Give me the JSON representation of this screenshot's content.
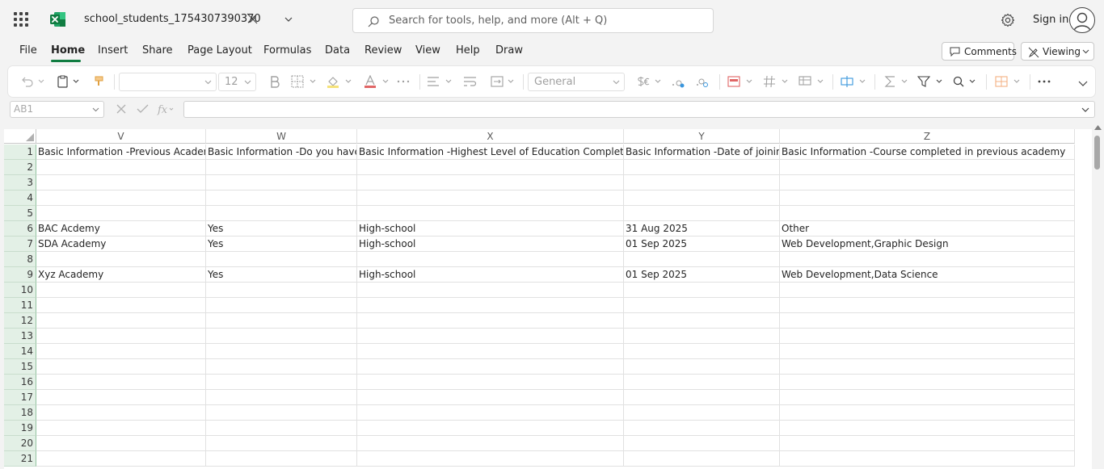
{
  "app": {
    "doc_title": "school_students_1754307390370",
    "search_placeholder": "Search for tools, help, and more (Alt + Q)",
    "signin_label": "Sign in",
    "brand_color": "#107c41"
  },
  "menu": {
    "tabs": [
      {
        "label": "File"
      },
      {
        "label": "Home"
      },
      {
        "label": "Insert"
      },
      {
        "label": "Share"
      },
      {
        "label": "Page Layout"
      },
      {
        "label": "Formulas"
      },
      {
        "label": "Data"
      },
      {
        "label": "Review"
      },
      {
        "label": "View"
      },
      {
        "label": "Help"
      },
      {
        "label": "Draw"
      }
    ],
    "active_tab": "Home",
    "comments_label": "Comments",
    "viewing_label": "Viewing"
  },
  "ribbon": {
    "font_name": "",
    "font_size": "12",
    "number_format": "General"
  },
  "formula_bar": {
    "name_box": "AB1",
    "formula": ""
  },
  "sheet": {
    "columns": [
      {
        "letter": "V"
      },
      {
        "letter": "W"
      },
      {
        "letter": "X"
      },
      {
        "letter": "Y"
      },
      {
        "letter": "Z"
      }
    ],
    "row_numbers": [
      "1",
      "2",
      "3",
      "4",
      "5",
      "6",
      "7",
      "8",
      "9",
      "10",
      "11",
      "12",
      "13",
      "14",
      "15",
      "16",
      "17",
      "18",
      "19",
      "20",
      "21"
    ],
    "rows": [
      [
        "Basic Information -Previous Academy",
        "Basic Information -Do you have a",
        "Basic Information -Highest Level of Education Completed",
        "Basic Information -Date of joining",
        "Basic Information -Course completed in previous academy"
      ],
      [
        "",
        "",
        "",
        "",
        ""
      ],
      [
        "",
        "",
        "",
        "",
        ""
      ],
      [
        "",
        "",
        "",
        "",
        ""
      ],
      [
        "",
        "",
        "",
        "",
        ""
      ],
      [
        "BAC Acdemy",
        "Yes",
        "High-school",
        "31 Aug 2025",
        "Other"
      ],
      [
        "SDA Academy",
        "Yes",
        "High-school",
        "01 Sep 2025",
        "Web Development,Graphic Design"
      ],
      [
        "",
        "",
        "",
        "",
        ""
      ],
      [
        "Xyz Academy",
        "Yes",
        "High-school",
        "01 Sep 2025",
        "Web Development,Data Science"
      ],
      [
        "",
        "",
        "",
        "",
        ""
      ],
      [
        "",
        "",
        "",
        "",
        ""
      ],
      [
        "",
        "",
        "",
        "",
        ""
      ],
      [
        "",
        "",
        "",
        "",
        ""
      ],
      [
        "",
        "",
        "",
        "",
        ""
      ],
      [
        "",
        "",
        "",
        "",
        ""
      ],
      [
        "",
        "",
        "",
        "",
        ""
      ],
      [
        "",
        "",
        "",
        "",
        ""
      ],
      [
        "",
        "",
        "",
        "",
        ""
      ],
      [
        "",
        "",
        "",
        "",
        ""
      ],
      [
        "",
        "",
        "",
        "",
        ""
      ],
      [
        "",
        "",
        "",
        "",
        ""
      ]
    ]
  }
}
